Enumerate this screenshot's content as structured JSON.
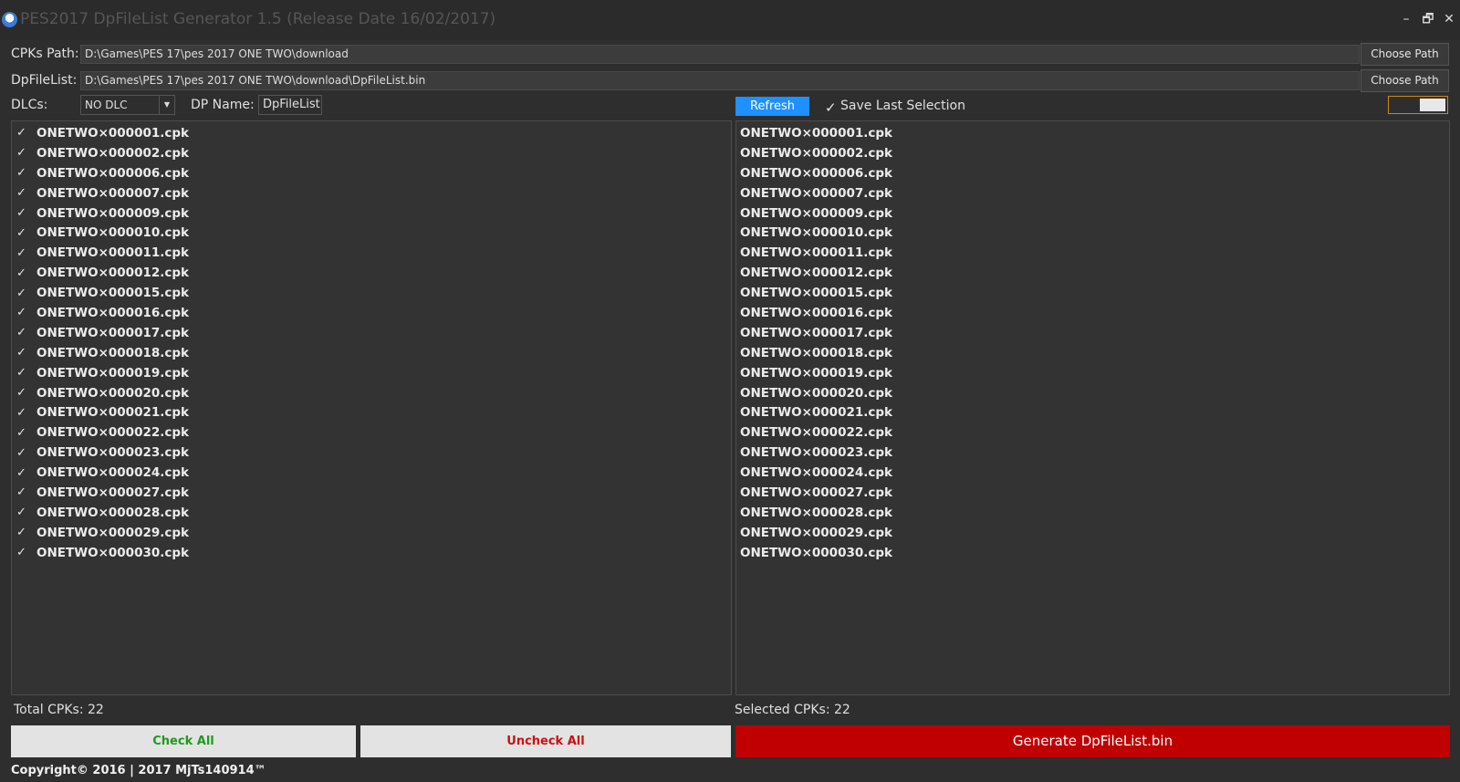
{
  "window": {
    "title": "PES2017 DpFileList Generator 1.5 (Release Date 16/02/2017)",
    "icon": "app-logo-icon",
    "minimize": "–",
    "restore": "🗗",
    "close": "✕"
  },
  "paths": {
    "cpks_label": "CPKs Path:",
    "cpks_value": "D:\\Games\\PES 17\\pes 2017 ONE TWO\\download",
    "dpfilelist_label": "DpFileList:",
    "dpfilelist_value": "D:\\Games\\PES 17\\pes 2017 ONE TWO\\download\\DpFileList.bin",
    "choose_label": "Choose Path"
  },
  "options": {
    "dlcs_label": "DLCs:",
    "dlc_selected": "NO DLC",
    "dp_name_label": "DP Name:",
    "dp_name_value": "DpFileList",
    "refresh_label": "Refresh",
    "save_last_label": "Save Last Selection",
    "save_last_checked": true
  },
  "files": [
    "ONETWO×000001.cpk",
    "ONETWO×000002.cpk",
    "ONETWO×000006.cpk",
    "ONETWO×000007.cpk",
    "ONETWO×000009.cpk",
    "ONETWO×000010.cpk",
    "ONETWO×000011.cpk",
    "ONETWO×000012.cpk",
    "ONETWO×000015.cpk",
    "ONETWO×000016.cpk",
    "ONETWO×000017.cpk",
    "ONETWO×000018.cpk",
    "ONETWO×000019.cpk",
    "ONETWO×000020.cpk",
    "ONETWO×000021.cpk",
    "ONETWO×000022.cpk",
    "ONETWO×000023.cpk",
    "ONETWO×000024.cpk",
    "ONETWO×000027.cpk",
    "ONETWO×000028.cpk",
    "ONETWO×000029.cpk",
    "ONETWO×000030.cpk"
  ],
  "status": {
    "total_label": "Total CPKs: 22",
    "selected_label": "Selected CPKs: 22"
  },
  "actions": {
    "check_all": "Check All",
    "uncheck_all": "Uncheck All",
    "generate": "Generate DpFileList.bin"
  },
  "footer": {
    "copyright": "Copyright© 2016 | 2017 MjTs140914™"
  },
  "colors": {
    "background": "#2e2e2e",
    "refresh": "#1e90ff",
    "generate": "#c00000",
    "check_all_text": "#1e9a1e",
    "uncheck_all_text": "#cc1010",
    "toggle_border": "#c98a1e"
  }
}
